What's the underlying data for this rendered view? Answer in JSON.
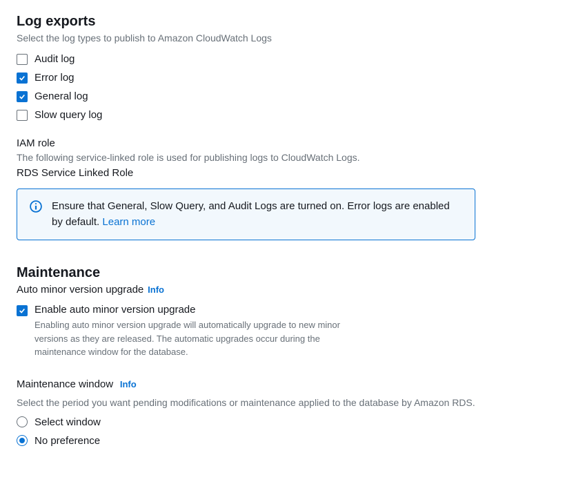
{
  "logExports": {
    "heading": "Log exports",
    "desc": "Select the log types to publish to Amazon CloudWatch Logs",
    "options": [
      {
        "label": "Audit log",
        "checked": false
      },
      {
        "label": "Error log",
        "checked": true
      },
      {
        "label": "General log",
        "checked": true
      },
      {
        "label": "Slow query log",
        "checked": false
      }
    ],
    "iamRoleLabel": "IAM role",
    "iamRoleDesc": "The following service-linked role is used for publishing logs to CloudWatch Logs.",
    "roleName": "RDS Service Linked Role",
    "infoText": "Ensure that General, Slow Query, and Audit Logs are turned on. Error logs are enabled by default. ",
    "infoLink": "Learn more"
  },
  "maintenance": {
    "heading": "Maintenance",
    "autoUpgradeLabel": "Auto minor version upgrade",
    "infoPill": "Info",
    "enableCheckbox": {
      "label": "Enable auto minor version upgrade",
      "checked": true,
      "desc": "Enabling auto minor version upgrade will automatically upgrade to new minor versions as they are released. The automatic upgrades occur during the maintenance window for the database."
    },
    "windowLabel": "Maintenance window",
    "windowDesc": "Select the period you want pending modifications or maintenance applied to the database by Amazon RDS.",
    "options": [
      {
        "label": "Select window",
        "selected": false
      },
      {
        "label": "No preference",
        "selected": true
      }
    ]
  }
}
